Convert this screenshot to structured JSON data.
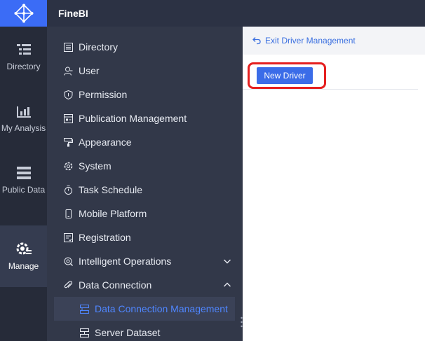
{
  "app": {
    "title": "FineBI"
  },
  "rail": {
    "items": [
      {
        "label": "Directory",
        "icon": "directory-list-icon"
      },
      {
        "label": "My Analysis",
        "icon": "chart-icon"
      },
      {
        "label": "Public Data",
        "icon": "database-icon"
      },
      {
        "label": "Manage",
        "icon": "gear-manage-icon",
        "active": true
      }
    ]
  },
  "nav": {
    "items": [
      {
        "label": "Directory",
        "icon": "list-icon"
      },
      {
        "label": "User",
        "icon": "user-icon"
      },
      {
        "label": "Permission",
        "icon": "shield-icon"
      },
      {
        "label": "Publication Management",
        "icon": "publication-icon"
      },
      {
        "label": "Appearance",
        "icon": "paint-roller-icon"
      },
      {
        "label": "System",
        "icon": "gear-icon"
      },
      {
        "label": "Task Schedule",
        "icon": "stopwatch-icon"
      },
      {
        "label": "Mobile Platform",
        "icon": "mobile-icon"
      },
      {
        "label": "Registration",
        "icon": "registration-icon"
      },
      {
        "label": "Intelligent Operations",
        "icon": "operations-icon",
        "expandable": true,
        "expanded": false
      },
      {
        "label": "Data Connection",
        "icon": "paperclip-icon",
        "expandable": true,
        "expanded": true
      }
    ],
    "sub_items": [
      {
        "label": "Data Connection Management",
        "icon": "connection-icon",
        "active": true
      },
      {
        "label": "Server Dataset",
        "icon": "server-icon"
      }
    ]
  },
  "main": {
    "exit_label": "Exit Driver Management",
    "new_driver_label": "New Driver"
  },
  "colors": {
    "accent": "#3b6cf6",
    "active_link": "#4f86ff",
    "highlight": "#e51f1f"
  }
}
